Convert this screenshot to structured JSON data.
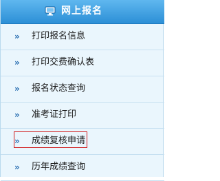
{
  "header": {
    "title": "网上报名",
    "icon": "monitor-icon"
  },
  "menu": {
    "items": [
      {
        "arrow": "»",
        "label": "打印报名信息"
      },
      {
        "arrow": "»",
        "label": "打印交费确认表"
      },
      {
        "arrow": "»",
        "label": "报名状态查询"
      },
      {
        "arrow": "»",
        "label": "准考证打印"
      },
      {
        "arrow": "»",
        "label": "成绩复核申请"
      },
      {
        "arrow": "»",
        "label": "历年成绩查询"
      }
    ]
  },
  "colors": {
    "header": "#3aa0e3",
    "background": "#eaf6fd",
    "highlight_border": "#d01717",
    "arrow": "#2a6fb2"
  }
}
